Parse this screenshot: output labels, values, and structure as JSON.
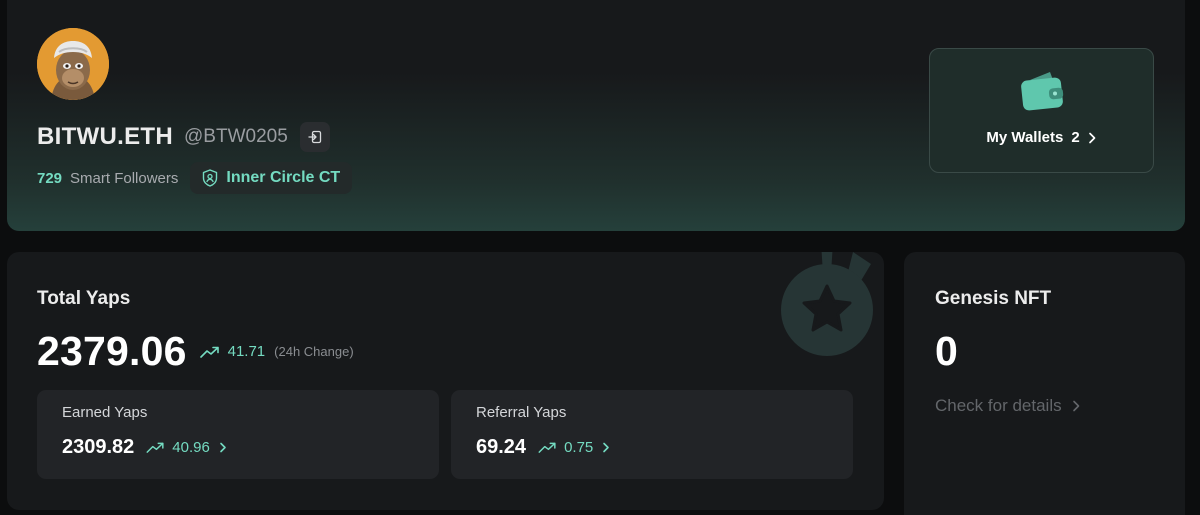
{
  "profile": {
    "display_name": "BITWU.ETH",
    "handle": "@BTW0205",
    "smart_followers_count": "729",
    "smart_followers_label": "Smart Followers",
    "tier_badge": "Inner Circle CT"
  },
  "wallet": {
    "label": "My Wallets",
    "count": "2"
  },
  "yaps": {
    "title": "Total Yaps",
    "total": "2379.06",
    "change": "41.71",
    "change_label": "(24h Change)",
    "earned": {
      "title": "Earned Yaps",
      "value": "2309.82",
      "change": "40.96"
    },
    "referral": {
      "title": "Referral Yaps",
      "value": "69.24",
      "change": "0.75"
    }
  },
  "genesis": {
    "title": "Genesis NFT",
    "value": "0",
    "link_label": "Check for details"
  },
  "colors": {
    "accent": "#74dbc1",
    "background": "#0c0d0e",
    "card": "#17191b"
  },
  "icons": [
    "avatar-ape",
    "external-link-icon",
    "shield-badge-icon",
    "wallet-icon",
    "chevron-right-icon",
    "trend-up-icon",
    "medal-star-icon"
  ]
}
